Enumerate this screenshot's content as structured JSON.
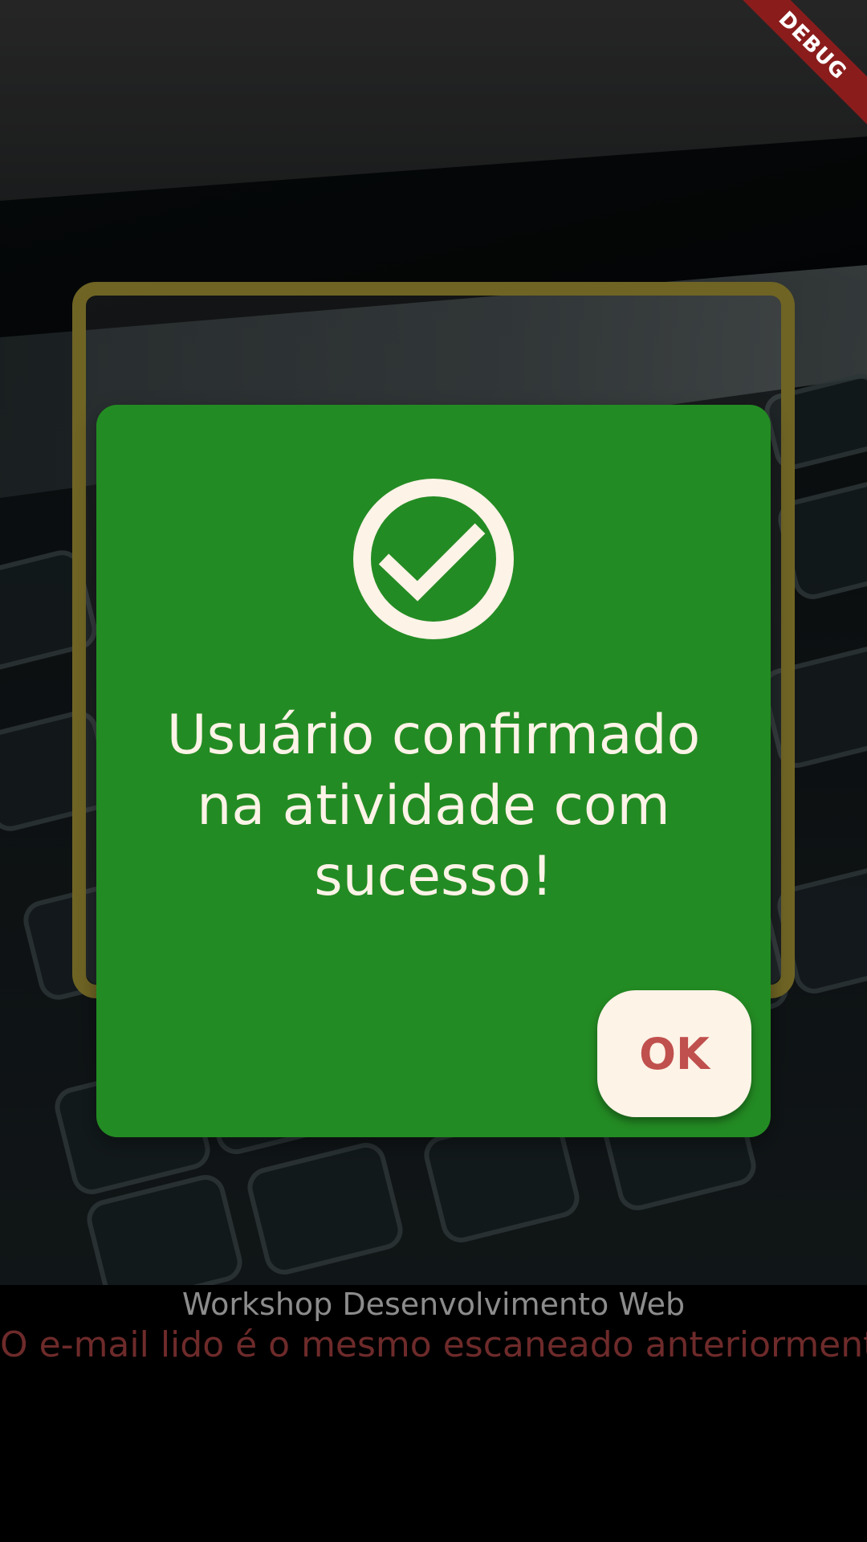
{
  "debug_banner": {
    "label": "DEBUG"
  },
  "dialog": {
    "icon": "check-circle-icon",
    "message": "Usuário confirmado na atividade com sucesso!",
    "ok_label": "OK"
  },
  "footer": {
    "event_title": "Workshop Desenvolvimento Web",
    "status_message": "O e-mail lido é o mesmo escaneado anteriormente!"
  },
  "colors": {
    "dialog_background": "#238b23",
    "dialog_text": "#fdf3e7",
    "ok_button_background": "#fdf3e7",
    "ok_button_text": "#c0504d",
    "scan_frame": "#6f6424",
    "status_message": "#6e2a2a",
    "event_title": "#8c8c8c",
    "debug_banner": "#8b1c1c"
  }
}
